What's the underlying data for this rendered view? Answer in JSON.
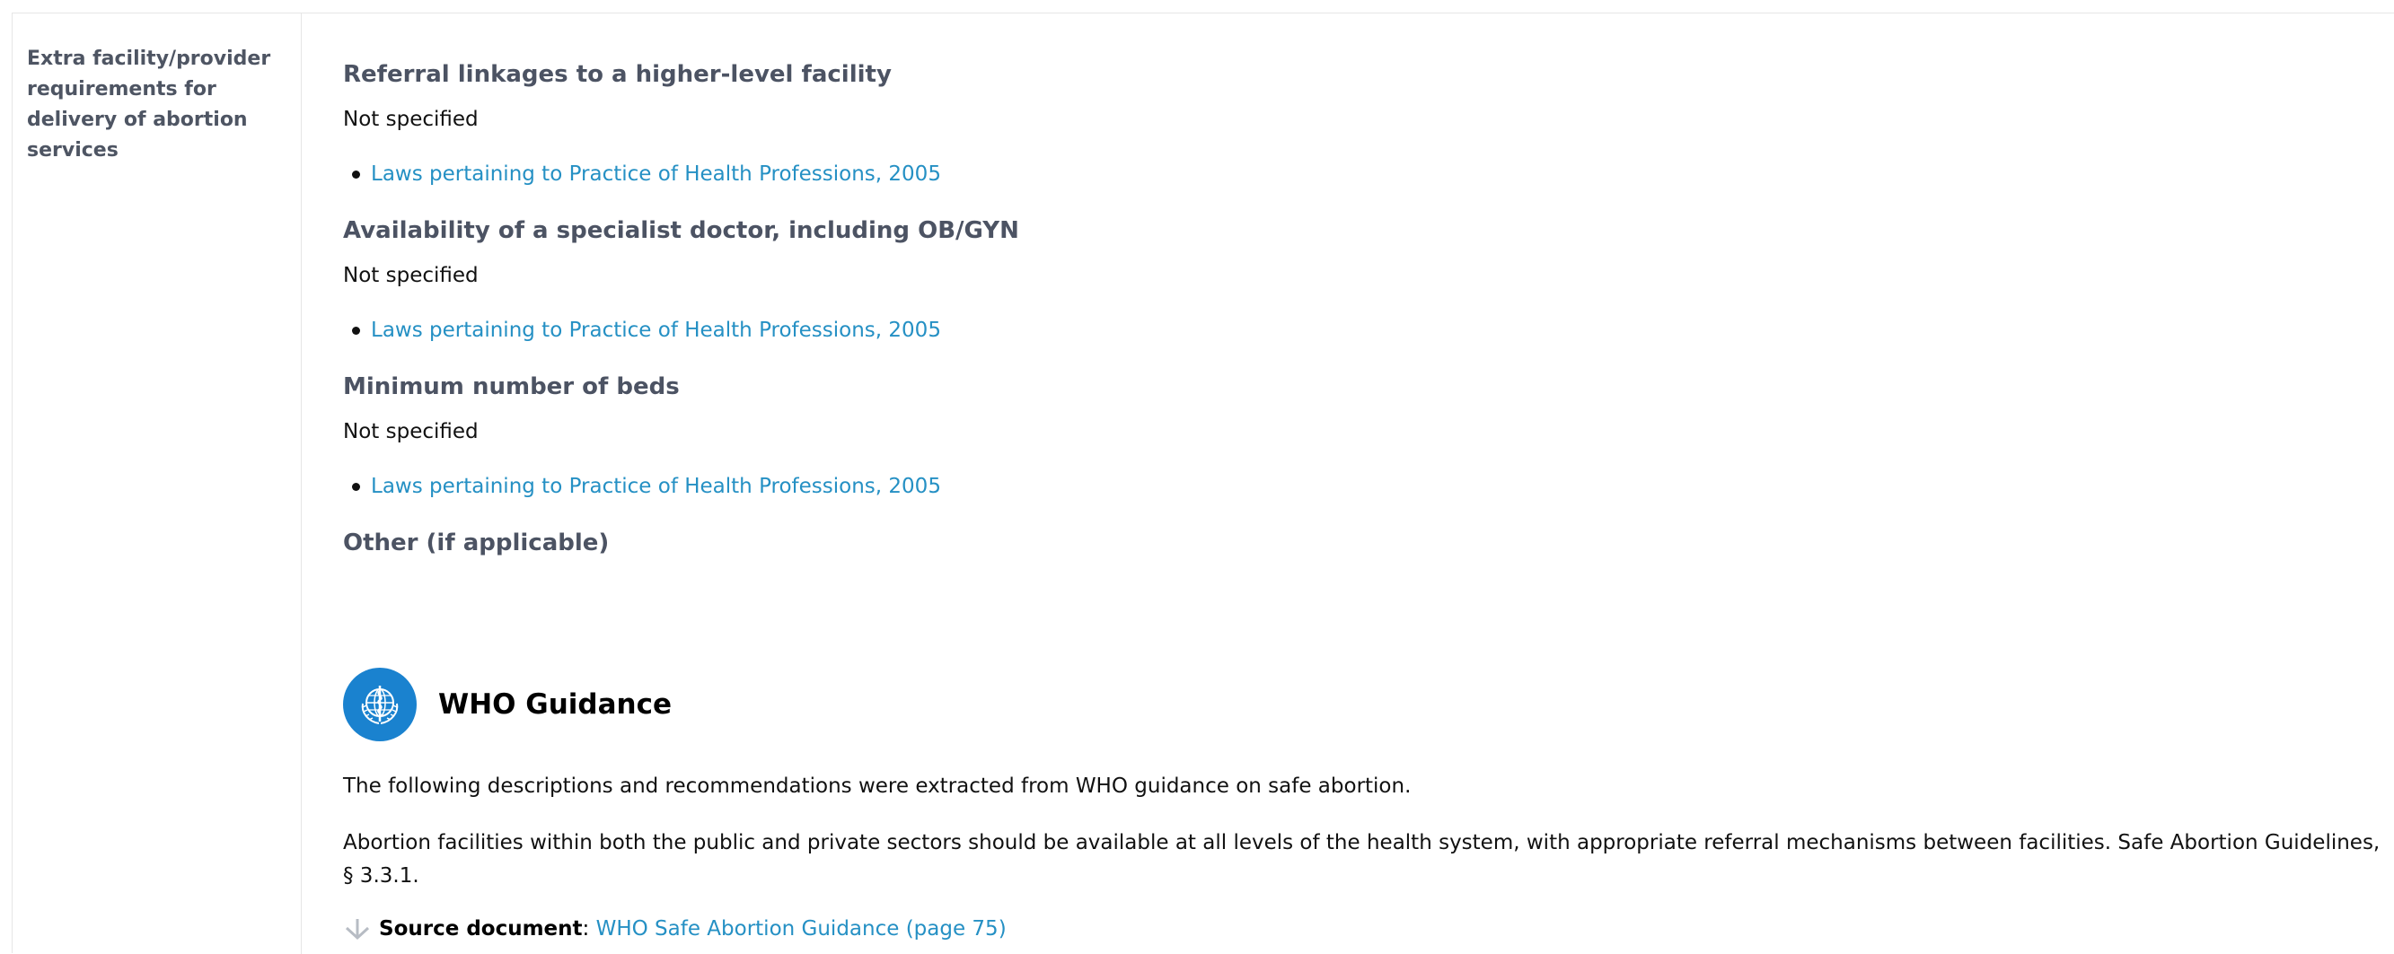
{
  "row_label": [
    "Extra facility/provider",
    "requirements for",
    "delivery of abortion",
    "services"
  ],
  "sections": [
    {
      "heading": "Referral linkages to a higher-level facility",
      "value": "Not specified",
      "link": "Laws pertaining to Practice of Health Professions, 2005"
    },
    {
      "heading": "Availability of a specialist doctor, including OB/GYN",
      "value": "Not specified",
      "link": "Laws pertaining to Practice of Health Professions, 2005"
    },
    {
      "heading": "Minimum number of beds",
      "value": "Not specified",
      "link": "Laws pertaining to Practice of Health Professions, 2005"
    },
    {
      "heading": "Other (if applicable)"
    }
  ],
  "who": {
    "title": "WHO Guidance",
    "intro": "The following descriptions and recommendations were extracted from WHO guidance on safe abortion.",
    "text": "Abortion facilities within both the public and private sectors should be available at all levels of the health system, with appropriate referral mechanisms between facilities. Safe Abortion Guidelines, § 3.3.1.",
    "source_label": "Source document",
    "source_sep": ":",
    "source_link": "WHO Safe Abortion Guidance (page 75)"
  },
  "colors": {
    "link": "#2590c4",
    "heading": "#4c5363",
    "who_logo": "#1a82cf"
  },
  "icons": {
    "who": "who-emblem-icon",
    "source": "download-arrow-icon"
  }
}
